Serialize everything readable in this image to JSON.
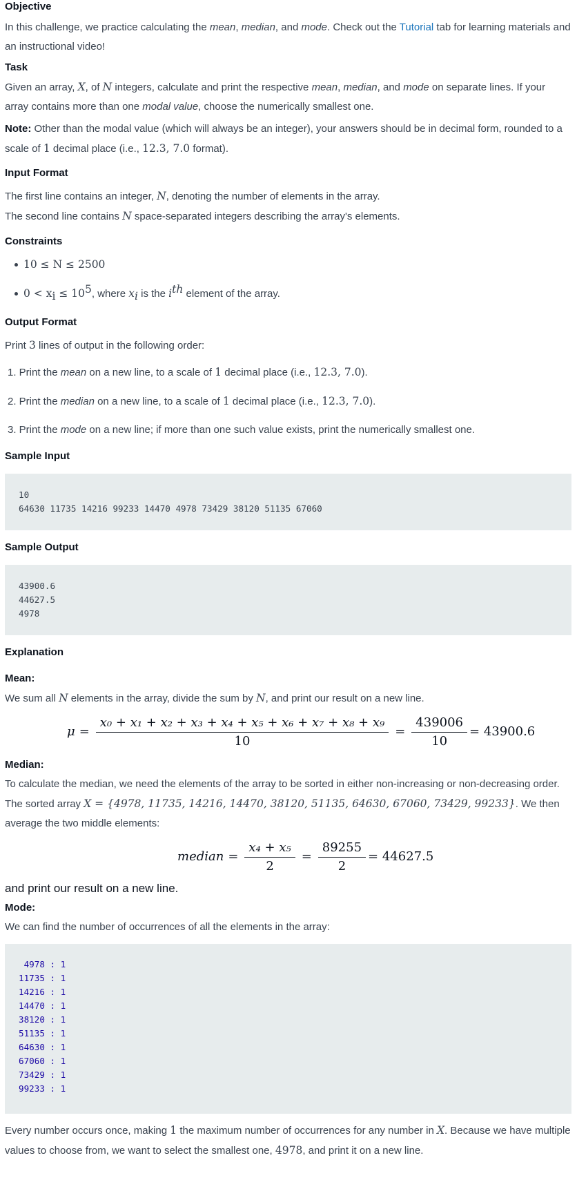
{
  "objective": {
    "heading": "Objective",
    "text_before": "In this challenge, we practice calculating the ",
    "mean": "mean",
    "comma1": ", ",
    "median": "median",
    "and": ", and ",
    "mode": "mode",
    "text_mid": ". Check out the ",
    "tutorial_link": "Tutorial",
    "text_after": " tab for learning materials and an instructional video!"
  },
  "task": {
    "heading": "Task",
    "text1": "Given an array, ",
    "X": "X",
    "text2": ", of ",
    "N": "N",
    "text3": " integers, calculate and print the respective ",
    "mean": "mean",
    "comma": ", ",
    "median": "median",
    "and": ", and ",
    "mode": "mode",
    "text4": " on separate lines. If your array contains more than one ",
    "modal_value": "modal value",
    "text5": ", choose the numerically smallest one.",
    "note_label": "Note:",
    "note_text1": " Other than the modal value (which will always be an integer), your answers should be in decimal form, rounded to a scale of ",
    "one": "1",
    "note_text2": " decimal place (i.e., ",
    "example": "12.3, 7.0",
    "note_text3": " format)."
  },
  "input_format": {
    "heading": "Input Format",
    "line1_a": "The first line contains an integer, ",
    "line1_N": "N",
    "line1_b": ", denoting the number of elements in the array.",
    "line2_a": "The second line contains ",
    "line2_N": "N",
    "line2_b": " space-separated integers describing the array's elements."
  },
  "constraints": {
    "heading": "Constraints",
    "c1": "10 ≤ N ≤ 2500",
    "c2_math": "0 < x",
    "c2_sub": "i",
    "c2_le": " ≤ 10",
    "c2_sup": "5",
    "c2_text": ", where ",
    "c2_xi": "x",
    "c2_xi_sub": "i",
    "c2_text2": " is the ",
    "c2_ith": "i",
    "c2_th": "th",
    "c2_text3": " element of the array."
  },
  "output_format": {
    "heading": "Output Format",
    "intro_a": "Print ",
    "intro_3": "3",
    "intro_b": " lines of output in the following order:",
    "item1_a": "1. Print the ",
    "item1_em": "mean",
    "item1_b": " on a new line, to a scale of ",
    "item1_one": "1",
    "item1_c": " decimal place (i.e., ",
    "item1_ex": "12.3, 7.0",
    "item1_d": ").",
    "item2_a": "2. Print the ",
    "item2_em": "median",
    "item2_b": " on a new line, to a scale of ",
    "item2_one": "1",
    "item2_c": " decimal place (i.e., ",
    "item2_ex": "12.3, 7.0",
    "item2_d": ").",
    "item3_a": "3. Print the ",
    "item3_em": "mode",
    "item3_b": " on a new line; if more than one such value exists, print the numerically smallest one."
  },
  "sample_input": {
    "heading": "Sample Input",
    "code": "10\n64630 11735 14216 99233 14470 4978 73429 38120 51135 67060"
  },
  "sample_output": {
    "heading": "Sample Output",
    "code": "43900.6\n44627.5\n4978"
  },
  "explanation": {
    "heading": "Explanation",
    "mean_heading": "Mean:",
    "mean_text_a": "We sum all ",
    "mean_N": "N",
    "mean_text_b": " elements in the array, divide the sum by ",
    "mean_N2": "N",
    "mean_text_c": ", and print our result on a new line.",
    "mean_eq": {
      "mu": "μ",
      "eq": "=",
      "numerator": "x₀ + x₁ + x₂ + x₃ + x₄ + x₅ + x₆ + x₇ + x₈ + x₉",
      "denominator": "10",
      "eq2": "=",
      "num2": "439006",
      "den2": "10",
      "result": "= 43900.6"
    },
    "median_heading": "Median:",
    "median_text_a": "To calculate the median, we need the elements of the array to be sorted in either non-increasing or non-decreasing order. The sorted array ",
    "median_set": "X = {4978, 11735, 14216, 14470, 38120, 51135, 64630, 67060, 73429, 99233}",
    "median_text_b": ". We then average the two middle elements:",
    "median_eq": {
      "label": "median",
      "eq": "=",
      "numerator": "x₄ + x₅",
      "denominator": "2",
      "eq2": "=",
      "num2": "89255",
      "den2": "2",
      "result": "= 44627.5"
    },
    "median_after": "and print our result on a new line.",
    "mode_heading": "Mode:",
    "mode_text": "We can find the number of occurrences of all the elements in the array:",
    "mode_code": " 4978 : 1\n11735 : 1\n14216 : 1\n14470 : 1\n38120 : 1\n51135 : 1\n64630 : 1\n67060 : 1\n73429 : 1\n99233 : 1",
    "final_a": "Every number occurs once, making ",
    "final_one": "1",
    "final_b": " the maximum number of occurrences for any number in ",
    "final_X": "X",
    "final_c": ". Because we have multiple values to choose from, we want to select the smallest one, ",
    "final_4978": "4978",
    "final_d": ", and print it on a new line."
  }
}
